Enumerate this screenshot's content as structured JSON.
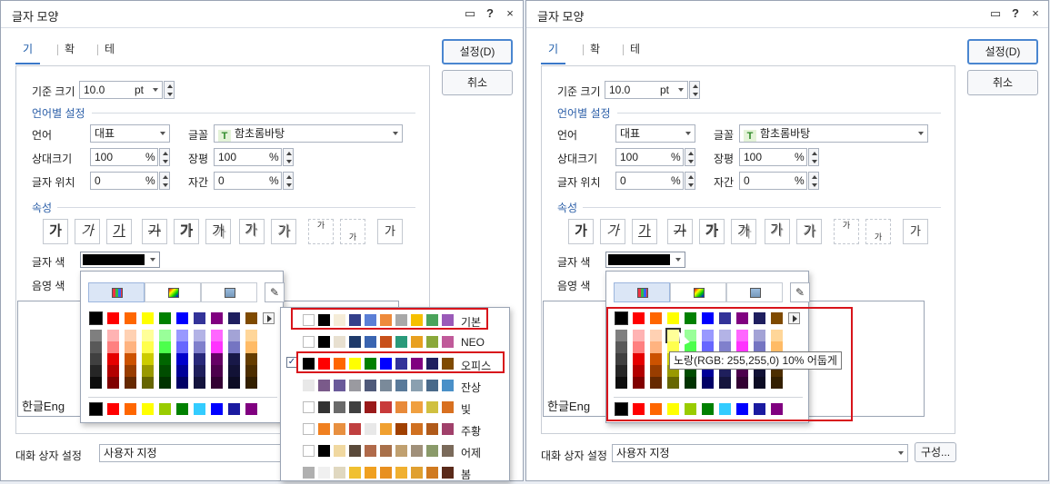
{
  "dialog": {
    "title": "글자 모양",
    "icons": {
      "help": "?",
      "close": "×"
    },
    "tabs": [
      "기본",
      "확장",
      "테두리/배경"
    ],
    "buttons": {
      "ok": "설정(D)",
      "cancel": "취소",
      "config": "구성..."
    },
    "base_size": {
      "label": "기준 크기",
      "value": "10.0",
      "unit": "pt"
    },
    "lang_section": "언어별 설정",
    "lang": {
      "label": "언어",
      "value": "대표"
    },
    "font": {
      "label": "글꼴",
      "value": "함초롬바탕",
      "icon": "TT"
    },
    "rel_size": {
      "label": "상대크기",
      "value": "100",
      "unit": "%"
    },
    "width": {
      "label": "장평",
      "value": "100",
      "unit": "%"
    },
    "position": {
      "label": "글자 위치",
      "value": "0",
      "unit": "%"
    },
    "spacing": {
      "label": "자간",
      "value": "0",
      "unit": "%"
    },
    "attr_section": "속성",
    "attr_glyph": "가",
    "text_color": {
      "label": "글자 색",
      "color": "#000000"
    },
    "shade_color": {
      "label": "음영 색"
    },
    "preview_text": "한글Eng",
    "dialog_setting": {
      "label": "대화 상자 설정",
      "value": "사용자 지정"
    }
  },
  "palette": {
    "top_row": [
      "#000000",
      "#ff0000",
      "#ff6600",
      "#ffff00",
      "#008000",
      "#0000ff",
      "#333399",
      "#800080",
      "#1f1f5f",
      "#7f4a00"
    ],
    "cols": [
      [
        "#7f7f7f",
        "#595959",
        "#404040",
        "#262626",
        "#0d0d0d"
      ],
      [
        "#ffb3b3",
        "#ff8080",
        "#e60000",
        "#b30000",
        "#800000"
      ],
      [
        "#ffd1b3",
        "#ffb380",
        "#cc5200",
        "#993d00",
        "#662900"
      ],
      [
        "#ffff99",
        "#ffff4d",
        "#cccc00",
        "#999900",
        "#666600"
      ],
      [
        "#99ff99",
        "#4dff4d",
        "#006600",
        "#004d00",
        "#003300"
      ],
      [
        "#9999ff",
        "#6666ff",
        "#0000cc",
        "#000099",
        "#000066"
      ],
      [
        "#b3b3e6",
        "#8080cc",
        "#29297a",
        "#1f1f5c",
        "#14143d"
      ],
      [
        "#ff66ff",
        "#ff33ff",
        "#660066",
        "#4d004d",
        "#330033"
      ],
      [
        "#a3a3d6",
        "#7575c2",
        "#181848",
        "#121236",
        "#0c0c24"
      ],
      [
        "#ffd699",
        "#ffbb66",
        "#663d00",
        "#4d2e00",
        "#331f00"
      ]
    ],
    "recent": [
      "#000000",
      "#ff0000",
      "#ff6600",
      "#ffff00",
      "#99cc00",
      "#008000",
      "#33ccff",
      "#0000ff",
      "#1a1aa0",
      "#800080"
    ]
  },
  "themes": [
    {
      "name": "기본",
      "checked": false,
      "colors": [
        "#ffffff",
        "#000000",
        "#f5ecd8",
        "#333f8a",
        "#5b7fd6",
        "#ee8a3b",
        "#a8a8a8",
        "#f6c000",
        "#4aa35a",
        "#9a5ab8"
      ]
    },
    {
      "name": "NEO",
      "checked": false,
      "colors": [
        "#ffffff",
        "#000000",
        "#e8e0d0",
        "#1f3a6a",
        "#3a64b0",
        "#c8501a",
        "#2a9a7a",
        "#e8a020",
        "#8aa83a",
        "#c05a9a"
      ]
    },
    {
      "name": "오피스",
      "checked": true,
      "colors": [
        "#000000",
        "#ff0000",
        "#ff6600",
        "#ffff00",
        "#008000",
        "#0000ff",
        "#333399",
        "#800080",
        "#1f1f5f",
        "#7f4a00"
      ]
    },
    {
      "name": "잔상",
      "checked": false,
      "colors": [
        "#e8e8e8",
        "#7a5a8a",
        "#6a5a9a",
        "#9a9aa0",
        "#505a7a",
        "#7a8a9a",
        "#5a7a9a",
        "#8aa0b0",
        "#4a6a8a",
        "#4a90c8"
      ]
    },
    {
      "name": "빛",
      "checked": false,
      "colors": [
        "#ffffff",
        "#333333",
        "#6a6a6a",
        "#404040",
        "#9a1a1a",
        "#c83a3a",
        "#e88a3a",
        "#f0a040",
        "#d0c040",
        "#d87020"
      ]
    },
    {
      "name": "주황",
      "checked": false,
      "colors": [
        "#ffffff",
        "#f08020",
        "#e89040",
        "#c04040",
        "#e8e8e8",
        "#f0a030",
        "#a04000",
        "#d07020",
        "#b05a1a",
        "#a0406a"
      ]
    },
    {
      "name": "어제",
      "checked": false,
      "colors": [
        "#ffffff",
        "#000000",
        "#f0d8a0",
        "#5a4a3a",
        "#b06a4a",
        "#a8704a",
        "#c0a070",
        "#a0907a",
        "#8a9a6a",
        "#7a6a5a"
      ]
    },
    {
      "name": "봄",
      "checked": false,
      "colors": [
        "#b0b0b0",
        "#f0f0f0",
        "#e0d8c0",
        "#f0c030",
        "#f0a020",
        "#e89020",
        "#f0b030",
        "#e0a030",
        "#d07a20",
        "#5a2a1a"
      ]
    }
  ],
  "tooltip": "노랑(RGB: 255,255,0) 10% 어둡게"
}
